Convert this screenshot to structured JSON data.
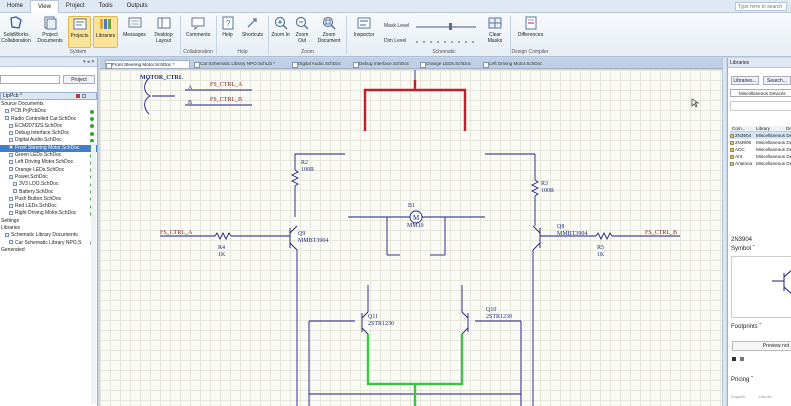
{
  "menu": {
    "items": [
      "Home",
      "View",
      "Project",
      "Tools",
      "Outputs"
    ],
    "active_index": 1
  },
  "search_help": "Type here to search",
  "ribbon": {
    "buttons": [
      {
        "label": "SolidWorks Collaboration",
        "icon": "solidworks-icon"
      },
      {
        "label": "Project Documents",
        "icon": "documents-icon"
      },
      {
        "label": "Projects",
        "icon": "projects-icon",
        "active": true
      },
      {
        "label": "Libraries",
        "icon": "libraries-icon",
        "active": true
      },
      {
        "label": "Messages",
        "icon": "messages-icon"
      },
      {
        "label": "Desktop Layout",
        "icon": "layout-icon"
      },
      {
        "label": "Comments",
        "icon": "comments-icon"
      },
      {
        "label": "Help",
        "icon": "help-icon"
      },
      {
        "label": "Shortcuts",
        "icon": "shortcuts-icon"
      },
      {
        "label": "Zoom In",
        "icon": "zoom-in-icon"
      },
      {
        "label": "Zoom Out",
        "icon": "zoom-out-icon"
      },
      {
        "label": "Zoom Document",
        "icon": "zoom-document-icon"
      },
      {
        "label": "Inspector",
        "icon": "inspector-icon"
      },
      {
        "label": "Clear Masks",
        "icon": "clear-masks-icon"
      },
      {
        "label": "Differences",
        "icon": "differences-icon"
      }
    ],
    "groups": [
      "System",
      "Collaboration",
      "Help",
      "Zoom",
      "Schematic",
      "Design Compiler"
    ],
    "mask_level_label": "Mask Level",
    "dim_level_label": "Dim Level",
    "mask_level": 0.55
  },
  "left_panel": {
    "project_button": "Project",
    "ltpcb_label": "LtpPcb *",
    "tree": [
      {
        "label": "Source Documents",
        "indent": 0
      },
      {
        "label": "PCB.PrjPcbDoc",
        "indent": 1,
        "dot": "green"
      },
      {
        "label": "Radio Controlled Car.SchDoc",
        "indent": 1,
        "dot": "green"
      },
      {
        "label": "ECM20732S.SchDoc",
        "indent": 2,
        "dot": "green"
      },
      {
        "label": "Debug Interface.SchDoc",
        "indent": 2,
        "dot": "green"
      },
      {
        "label": "Digital Audio.SchDoc",
        "indent": 2,
        "dot": "green"
      },
      {
        "label": "Front Steering Motor.SchDoc",
        "indent": 2,
        "dot": "green",
        "selected": true
      },
      {
        "label": "Green LEDs.SchDoc",
        "indent": 2,
        "dot": "green"
      },
      {
        "label": "Left Driving Motor.SchDoc",
        "indent": 2,
        "dot": "green"
      },
      {
        "label": "Orange LEDs.SchDoc",
        "indent": 2,
        "dot": "green"
      },
      {
        "label": "Power.SchDoc",
        "indent": 2,
        "dot": "green"
      },
      {
        "label": "3V3 LDO.SchDoc",
        "indent": 3,
        "dot": "green"
      },
      {
        "label": "Battery.SchDoc",
        "indent": 3,
        "dot": "green"
      },
      {
        "label": "Push Button.SchDoc",
        "indent": 2,
        "dot": "green"
      },
      {
        "label": "Red LEDs.SchDoc",
        "indent": 2,
        "dot": "green"
      },
      {
        "label": "Right Driving Motor.SchDoc",
        "indent": 2,
        "dot": "green"
      },
      {
        "label": "Settings",
        "indent": 0
      },
      {
        "label": "Libraries",
        "indent": 0
      },
      {
        "label": "Schematic Library Documents",
        "indent": 1
      },
      {
        "label": "Car Schematic Library NPO.S",
        "indent": 2,
        "dot": "gray"
      },
      {
        "label": "Generated",
        "indent": 0
      }
    ]
  },
  "doc_tabs": [
    {
      "label": "Front Steering Motor.SchDoc *",
      "active": true
    },
    {
      "label": "Car Schematic Library NPO.SchLib *"
    },
    {
      "label": "Digital Audio.SchDoc"
    },
    {
      "label": "Debug Interface.SchDoc"
    },
    {
      "label": "Orange LEDs.SchDoc"
    },
    {
      "label": "Left Driving Motor.SchDoc"
    }
  ],
  "schematic": {
    "sheet_symbol": "MOTOR_CTRL",
    "pin_a": "A",
    "pin_b": "B",
    "net_fs_ctrl_a": "FS_CTRL_A",
    "net_fs_ctrl_b": "FS_CTRL_B",
    "components": {
      "r2": {
        "ref": "R2",
        "value": "100R"
      },
      "r3": {
        "ref": "R3",
        "value": "100R"
      },
      "r4": {
        "ref": "R4",
        "value": "1K"
      },
      "r5": {
        "ref": "R5",
        "value": "1K"
      },
      "b1": {
        "ref": "B1",
        "value": "MM10"
      },
      "q9": {
        "ref": "Q9",
        "value": "MMBT3904"
      },
      "q8": {
        "ref": "Q8",
        "value": "MMBT3904"
      },
      "q11": {
        "ref": "Q11",
        "value": "2STR1230"
      },
      "q10": {
        "ref": "Q10",
        "value": "2STR1230"
      }
    }
  },
  "right_panel": {
    "title": "Libraries",
    "libraries_button": "Libraries...",
    "search_button": "Search...",
    "library_dropdown": "Miscellaneous Devices",
    "table_headers": [
      "Com...",
      "Library",
      "De"
    ],
    "rows": [
      {
        "com": "2N3904",
        "lib": "Miscellaneous Devices"
      },
      {
        "com": "2N3906",
        "lib": "Miscellaneous Devices"
      },
      {
        "com": "ADC",
        "lib": "Miscellaneous Devices"
      },
      {
        "com": "Ant",
        "lib": "Miscellaneous Devices"
      },
      {
        "com": "Antenna",
        "lib": "Miscellaneous Devices"
      }
    ],
    "component_name": "2N3904",
    "symbol_label": "Symbol",
    "footprints_label": "Footprints",
    "preview_button": "Preview not",
    "pricing_label": "Pricing",
    "supplier_text": "Supplier",
    "handle_text": "Handle"
  },
  "colors": {
    "wire": "#1e1e7a",
    "highlight_red": "#c21f2a",
    "highlight_green": "#3fc24a",
    "selection": "#3f7fd1"
  }
}
